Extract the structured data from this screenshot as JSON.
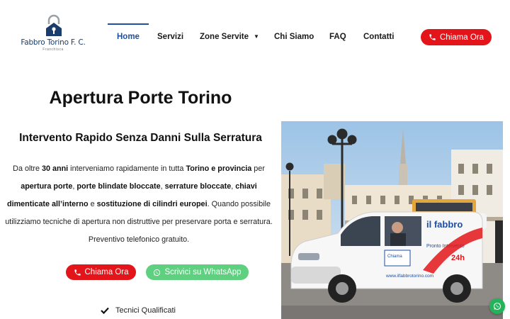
{
  "logo": {
    "brand": "Fabbro Torino F. C.",
    "sub": "Franchisca"
  },
  "nav": {
    "items": [
      {
        "label": "Home",
        "active": true
      },
      {
        "label": "Servizi"
      },
      {
        "label": "Zone Servite",
        "has_dropdown": true
      },
      {
        "label": "Chi Siamo"
      },
      {
        "label": "FAQ"
      },
      {
        "label": "Contatti"
      }
    ],
    "cta": "Chiama Ora"
  },
  "hero": {
    "title": "Apertura Porte Torino",
    "subtitle": "Intervento Rapido Senza Danni Sulla Serratura",
    "paragraph": [
      {
        "t": "Da oltre "
      },
      {
        "t": "30 anni",
        "b": true
      },
      {
        "t": " interveniamo rapidamente in tutta "
      },
      {
        "t": "Torino e provincia",
        "b": true
      },
      {
        "t": " per "
      },
      {
        "t": "apertura porte",
        "b": true
      },
      {
        "t": ", "
      },
      {
        "t": "porte blindate bloccate",
        "b": true
      },
      {
        "t": ", "
      },
      {
        "t": "serrature bloccate",
        "b": true
      },
      {
        "t": ", "
      },
      {
        "t": "chiavi dimenticate all’interno",
        "b": true
      },
      {
        "t": " e "
      },
      {
        "t": "sostituzione di cilindri europei",
        "b": true
      },
      {
        "t": ". Quando possibile utilizziamo tecniche di apertura non distruttive per preservare porta e serratura. Preventivo telefonico gratuito."
      }
    ],
    "call_button": "Chiama Ora",
    "whatsapp_button": "Scrivici su WhatsApp",
    "features": [
      "Tecnici Qualificati"
    ]
  },
  "photo": {
    "van_brand": "il fabbro",
    "van_slogan": "Pronto Intervento",
    "van_hours": "24h",
    "van_phone_label": "Chiama",
    "van_url": "www.ilfabbrotorino.com"
  },
  "colors": {
    "brand_blue": "#1e4fa1",
    "cta_red": "#e3151a",
    "whatsapp_green": "#5fd07f"
  },
  "icons": [
    "lock-logo-icon",
    "phone-icon",
    "whatsapp-icon",
    "check-icon",
    "chevron-down-icon"
  ]
}
